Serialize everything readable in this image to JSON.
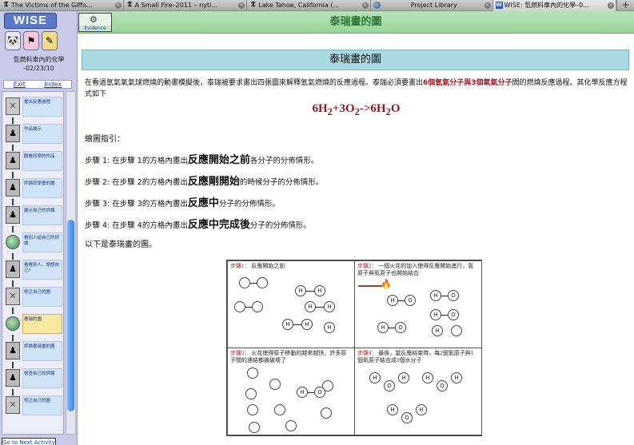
{
  "tabs": [
    {
      "title": "The Victims of the Giffo...",
      "icon": "nyt-icon"
    },
    {
      "title": "A Small Fire–2011 – nyti...",
      "icon": "nyt-icon"
    },
    {
      "title": "Lake Tahoe, California (...",
      "icon": "nyt-icon"
    },
    {
      "title": "Project Library",
      "icon": "globe-icon"
    },
    {
      "title": "WISE: 氫燃料車內的化學–0...",
      "icon": "wise-icon"
    }
  ],
  "sidebar": {
    "logo": "WISE",
    "project_title": "氫燃料車內的化學",
    "project_date": "-02/23/10",
    "exit": "Exit",
    "index": "Index",
    "steps": [
      {
        "label": "畫出反應過程",
        "icon": "x"
      },
      {
        "label": "作品展示",
        "icon": "person"
      },
      {
        "label": "觀看同學的作品",
        "icon": "person"
      },
      {
        "label": "評論同學畫的圖",
        "icon": "person"
      },
      {
        "label": "展示自己的評論",
        "icon": "person"
      },
      {
        "label": "看別人給自己的評論",
        "icon": "globe"
      },
      {
        "label": "看看別人，想想自己?",
        "icon": "person"
      },
      {
        "label": "修正自己的圖",
        "icon": "x"
      },
      {
        "label": "泰瑞的圖",
        "icon": "globe"
      },
      {
        "label": "評論泰瑞畫的圖",
        "icon": "person"
      },
      {
        "label": "檢查自己的評論",
        "icon": "person"
      },
      {
        "label": "修正自己的圖",
        "icon": "x"
      }
    ],
    "current_step_index": 8,
    "next_button": "Go to Next Activity"
  },
  "header": {
    "evidence_label": "Evidence",
    "title": "泰瑞畫的圖"
  },
  "content": {
    "heading": "泰瑞畫的圖",
    "intro_before": "在看過氫氣氧氣球燃燒的動畫模擬後，泰瑞被要求畫出四張圖來解釋氫氣燃燒的反應過程。泰瑞必須要畫出",
    "intro_highlight1": "6個氫氣分子與3個氧氣分子",
    "intro_after": "間的燃燒反應過程。其化學反應方程式如下",
    "equation_parts": [
      "6H",
      "2",
      "+3O",
      "2",
      "->6H",
      "2",
      "O"
    ],
    "guide_title": "繪圖指引：",
    "instructions": [
      {
        "prefix": "步驟 1: 在步驟 1的方格內畫出",
        "bold": "反應開始之前",
        "suffix": "各分子的分佈情形。"
      },
      {
        "prefix": "步驟 2: 在步驟 2的方格內畫出",
        "bold": "反應剛開始",
        "suffix": "的時候分子的分佈情形。"
      },
      {
        "prefix": "步驟 3: 在步驟 3的方格內畫出",
        "bold": "反應中",
        "suffix": "分子的分佈情形。"
      },
      {
        "prefix": "步驟 4: 在步驟 4的方格內畫出",
        "bold": "反應中完成後",
        "suffix": "分子的分佈情形。"
      }
    ],
    "below_text": "以下是泰瑞畫的圖。",
    "drawing": {
      "panels": [
        {
          "step": "步驟1：",
          "text": "反應開始之前"
        },
        {
          "step": "步驟2：",
          "text": "一個火花的加入使得反應開始進行，氫原子與氧原子也開始結合"
        },
        {
          "step": "步驟3：",
          "text": "火花使得原子移動的越來越快，許多原子間的連結都被破壞了"
        },
        {
          "step": "步驟4：",
          "text": "最後，當反應結束時，每2個氫原子與1個氧原子結合成1個水分子"
        }
      ],
      "atom_h": "H",
      "atom_o": "O"
    }
  }
}
